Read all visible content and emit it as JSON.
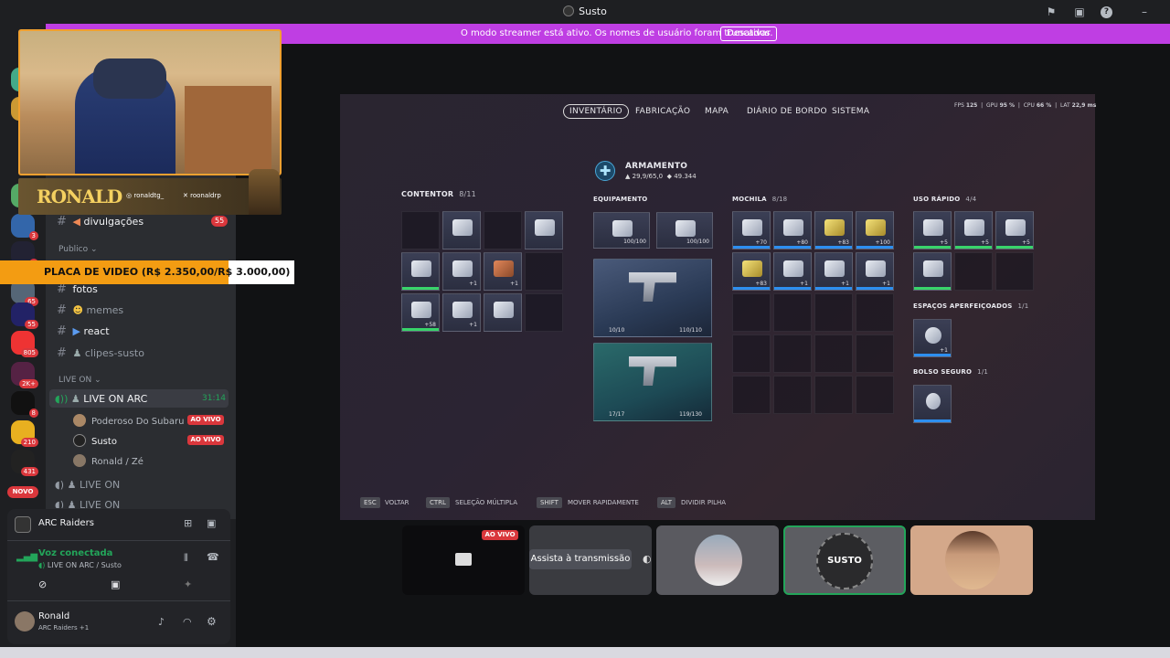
{
  "window": {
    "title": "Susto"
  },
  "streamer_bar": {
    "message": "O modo streamer está ativo. Os nomes de usuário foram truncados.",
    "button": "Desativar"
  },
  "servers": [
    {
      "badge": "3"
    },
    {
      "badge": "4"
    },
    {
      "badge": "65"
    },
    {
      "badge": "55"
    },
    {
      "badge": "805"
    },
    {
      "badge": "2K+"
    },
    {
      "badge": "8"
    },
    {
      "badge": "210"
    },
    {
      "badge": "431"
    }
  ],
  "new_badge": "NOVO",
  "overlay": {
    "streamer_name": "RONALD",
    "social_1": "ronaldtg_",
    "social_2": "roonaldrp",
    "ticker": "PLACA DE VIDEO (R$ 2.350,00/R$ 3.000,00)"
  },
  "channels": {
    "divulgacoes": {
      "name": "divulgações",
      "badge": "55"
    },
    "category_publico": "Publico",
    "fotos": "fotos",
    "memes": "memes",
    "react": "react",
    "clipes": "clipes-susto",
    "category_live": "LIVE ON",
    "live_arc": {
      "name": "LIVE ON ARC",
      "timer": "31:14"
    },
    "members": [
      {
        "name": "Poderoso Do Subaru",
        "badge": "AO VIVO"
      },
      {
        "name": "Susto",
        "badge": "AO VIVO"
      },
      {
        "name": "Ronald / Zé",
        "badge": ""
      }
    ],
    "live_on": "LIVE ON",
    "live_on_2": "LIVE ON"
  },
  "panel": {
    "activity": "ARC Raiders",
    "voice_status": "Voz conectada",
    "voice_channel": "LIVE ON ARC / Susto",
    "user_name": "Ronald",
    "user_status": "ARC Raiders +1"
  },
  "game": {
    "tabs": [
      "INVENTÁRIO",
      "FABRICAÇÃO",
      "MAPA",
      "DIÁRIO DE BORDO",
      "SISTEMA"
    ],
    "stats": {
      "fps_label": "FPS",
      "fps": "125",
      "gpu_label": "GPU",
      "gpu": "95 %",
      "cpu_label": "CPU",
      "cpu": "66 %",
      "lat_label": "LAT",
      "lat": "22,9 ms"
    },
    "armamento": {
      "title": "ARMAMENTO",
      "weight": "29,9/65,0",
      "money": "49.344"
    },
    "contentor": {
      "title": "CONTENTOR",
      "count": "8/11",
      "counts": [
        "",
        "",
        "",
        "+1",
        "+1",
        "+58",
        "+1",
        "",
        "",
        "+2",
        "1"
      ]
    },
    "equipamento": {
      "title": "EQUIPAMENTO",
      "slot1": "100/100",
      "slot2": "100/100"
    },
    "weapon1": {
      "ammo": "10/10",
      "dur": "110/110"
    },
    "weapon2": {
      "ammo": "17/17",
      "dur": "119/130"
    },
    "mochila": {
      "title": "MOCHILA",
      "count": "8/18",
      "counts": [
        "+70",
        "+80",
        "+83",
        "+100",
        "+83",
        "+1",
        "+1",
        "+1"
      ]
    },
    "uso_rapido": {
      "title": "USO RÁPIDO",
      "count": "4/4",
      "counts": [
        "+5",
        "+5",
        "+5",
        ""
      ]
    },
    "espacos": {
      "title": "ESPAÇOS APERFEIÇOADOS",
      "count": "1/1",
      "slot": "+1"
    },
    "bolso": {
      "title": "BOLSO SEGURO",
      "count": "1/1"
    },
    "keys": [
      {
        "key": "ESC",
        "label": "VOLTAR"
      },
      {
        "key": "CTRL",
        "label": "SELEÇÃO MÚLTIPLA"
      },
      {
        "key": "SHIFT",
        "label": "MOVER RAPIDAMENTE"
      },
      {
        "key": "ALT",
        "label": "DIVIDIR PILHA"
      }
    ]
  },
  "participants": {
    "live_badge": "AO VIVO",
    "watch_button": "Assista à transmissão",
    "susto_logo": "SUSTO"
  },
  "colors": {
    "streamer_bar": "#bf3ee3",
    "accent_green": "#23a55a",
    "live_red": "#da373c",
    "ticker_orange": "#f39c12"
  }
}
